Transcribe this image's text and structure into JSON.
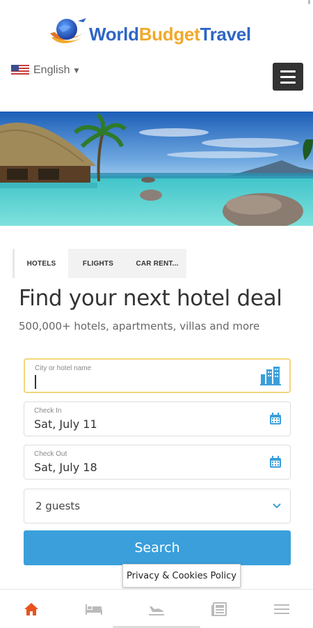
{
  "brand": {
    "part1": "World",
    "part2": "Budget",
    "part3": "Travel"
  },
  "language": {
    "label": "English",
    "flag": "us-flag-icon"
  },
  "menu": {
    "icon": "hamburger-menu-icon"
  },
  "hero": {
    "alt": "tropical-resort-beach-image"
  },
  "tabs": [
    {
      "label": "HOTELS",
      "active": true
    },
    {
      "label": "FLIGHTS",
      "active": false
    },
    {
      "label": "CAR RENT...",
      "active": false
    }
  ],
  "heading": "Find your next hotel deal",
  "subheading": "500,000+ hotels, apartments, villas and more",
  "form": {
    "destination": {
      "label": "City or hotel name",
      "value": "",
      "icon": "city-buildings-icon"
    },
    "check_in": {
      "label": "Check In",
      "value": "Sat, July 11",
      "icon": "calendar-icon"
    },
    "check_out": {
      "label": "Check Out",
      "value": "Sat, July 18",
      "icon": "calendar-icon"
    },
    "guests": {
      "value": "2 guests",
      "icon": "chevron-down-icon"
    },
    "search_label": "Search"
  },
  "cookie_label": "Privacy & Cookies Policy",
  "bottom_nav": [
    {
      "name": "home",
      "icon": "home-icon",
      "active": true
    },
    {
      "name": "hotels",
      "icon": "bed-icon",
      "active": false
    },
    {
      "name": "flights",
      "icon": "plane-landing-icon",
      "active": false
    },
    {
      "name": "news",
      "icon": "newspaper-icon",
      "active": false
    },
    {
      "name": "more",
      "icon": "menu-lines-icon",
      "active": false
    }
  ],
  "colors": {
    "accent_blue": "#3a9fdb",
    "brand_blue": "#2f66c4",
    "brand_orange": "#f1a92a",
    "active_nav": "#e8521d",
    "focus_border": "#f2d77a"
  }
}
